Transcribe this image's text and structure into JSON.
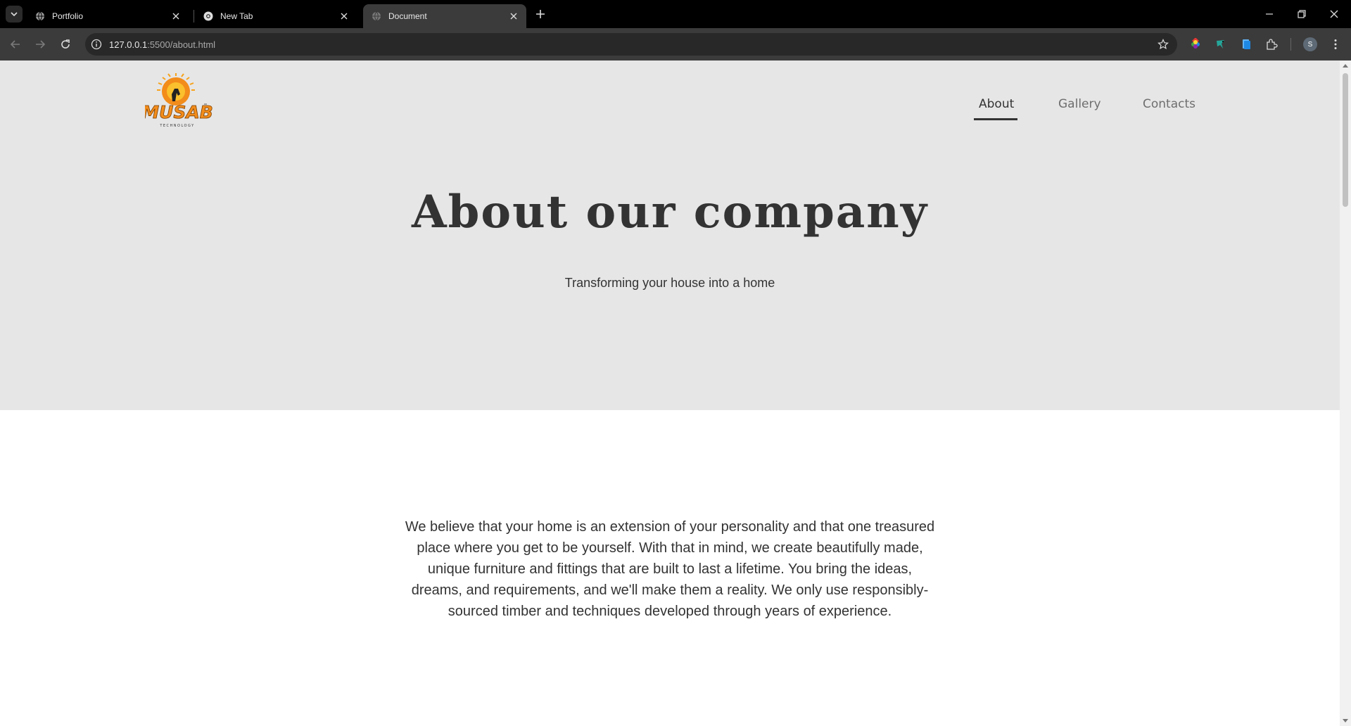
{
  "browser": {
    "tabs": [
      {
        "title": "Portfolio",
        "active": false
      },
      {
        "title": "New Tab",
        "active": false
      },
      {
        "title": "Document",
        "active": true
      }
    ],
    "url_host": "127.0.0.1",
    "url_path": ":5500/about.html",
    "profile_initial": "S"
  },
  "site": {
    "logo_alt": "MUSAB",
    "nav": [
      {
        "label": "About",
        "active": true
      },
      {
        "label": "Gallery",
        "active": false
      },
      {
        "label": "Contacts",
        "active": false
      }
    ],
    "hero": {
      "title": "About our company",
      "subtitle": "Transforming your house into a home"
    },
    "about_paragraph": "We believe that your home is an extension of your personality and that one treasured place where you get to be yourself. With that in mind, we create beautifully made, unique furniture and fittings that are built to last a lifetime. You bring the ideas, dreams, and requirements, and we'll make them a reality. We only use responsibly-sourced timber and techniques developed through years of experience."
  },
  "colors": {
    "hero_bg": "#e6e6e6",
    "text": "#333333",
    "logo_orange": "#f28c1b"
  }
}
